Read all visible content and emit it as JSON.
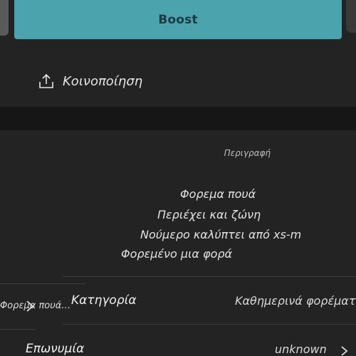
{
  "header": {
    "boost_label": "Boost"
  },
  "share": {
    "label": "Κοινοποίηση"
  },
  "description": {
    "header": "Περιγραφή",
    "lines": [
      "Φορεμα πουά",
      "Περιέχει και ζώνη",
      "Νούμερο καλύπτει από xs-m",
      "Φορεμένο μια φορά"
    ]
  },
  "details": {
    "left_item_label": "Φορεμα πουά…",
    "category_label": "Κατηγορία",
    "category_value": "Καθημερινά φορέματα",
    "condition_label": "Επωνυμία",
    "condition_value": "unknown"
  },
  "colors": {
    "boost_bg": "#4aa3ad",
    "background": "#232323",
    "band": "#161616"
  },
  "icons": {
    "share": "share-icon",
    "left_chevron": "chevron-right-icon",
    "right_chevron": "chevron-right-icon"
  }
}
